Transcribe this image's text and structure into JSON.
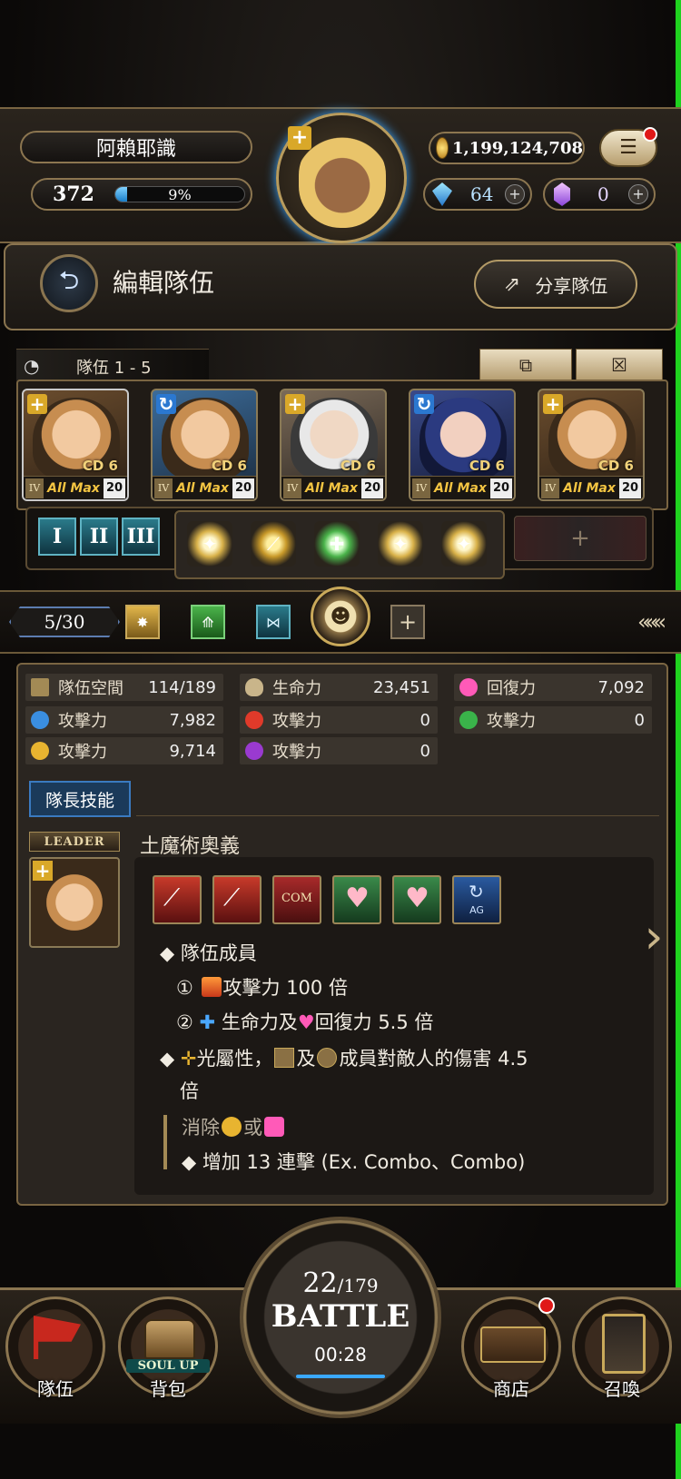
{
  "player": {
    "name": "阿賴耶識",
    "level": "372",
    "exp_percent": "9%",
    "exp_fraction": 0.09
  },
  "currency": {
    "gold": "1,199,124,708",
    "diamonds": "64",
    "crystals": "0"
  },
  "header": {
    "title": "編輯隊伍",
    "share_label": "分享隊伍"
  },
  "team": {
    "tab_label": "隊伍 1 - 5",
    "members": [
      {
        "cd": "CD 6",
        "rank": "IV",
        "status": "All Max",
        "level": "20",
        "leader": true
      },
      {
        "cd": "CD 6",
        "rank": "IV",
        "status": "All Max",
        "level": "20",
        "leader": false
      },
      {
        "cd": "CD 6",
        "rank": "IV",
        "status": "All Max",
        "level": "20",
        "leader": false
      },
      {
        "cd": "CD 6",
        "rank": "IV",
        "status": "All Max",
        "level": "20",
        "leader": false
      },
      {
        "cd": "CD 6",
        "rank": "IV",
        "status": "All Max",
        "level": "20",
        "leader": false
      }
    ],
    "presets": [
      "I",
      "II",
      "III"
    ],
    "count": "5/30"
  },
  "stats": {
    "space_label": "隊伍空間",
    "space_value": "114/189",
    "hp_label": "生命力",
    "hp_value": "23,451",
    "recovery_label": "回復力",
    "recovery_value": "7,092",
    "water_atk_label": "攻擊力",
    "water_atk_value": "7,982",
    "fire_atk_label": "攻擊力",
    "fire_atk_value": "0",
    "wood_atk_label": "攻擊力",
    "wood_atk_value": "0",
    "light_atk_label": "攻擊力",
    "light_atk_value": "9,714",
    "dark_atk_label": "攻擊力",
    "dark_atk_value": "0"
  },
  "leader_skill": {
    "tab_label": "隊長技能",
    "badge": "LEADER",
    "name": "土魔術奧義",
    "com_label": "COM",
    "ag_label": "AG",
    "line1": "隊伍成員",
    "line2_num": "①",
    "line2": "攻擊力 100 倍",
    "line3_num": "②",
    "line3a": "生命力及",
    "line3b": "回復力 5.5 倍",
    "line4a": "光屬性，",
    "line4b": "及",
    "line4c": "成員對敵人的傷害 4.5",
    "line4d": "倍",
    "line5a": "消除",
    "line5b": "或",
    "line6": "增加 13 連擊 (Ex. Combo、Combo)"
  },
  "battle": {
    "stamina": "22",
    "stamina_max": "/179",
    "label": "BATTLE",
    "timer": "00:28"
  },
  "nav": {
    "team": "隊伍",
    "bag": "背包",
    "soul_up": "SOUL UP",
    "shop": "商店",
    "summon": "召喚"
  },
  "colors": {
    "gold": "#a38a55",
    "panel": "#2a2520",
    "accent_blue": "#1e8ad0",
    "badge_red": "#e01818"
  }
}
